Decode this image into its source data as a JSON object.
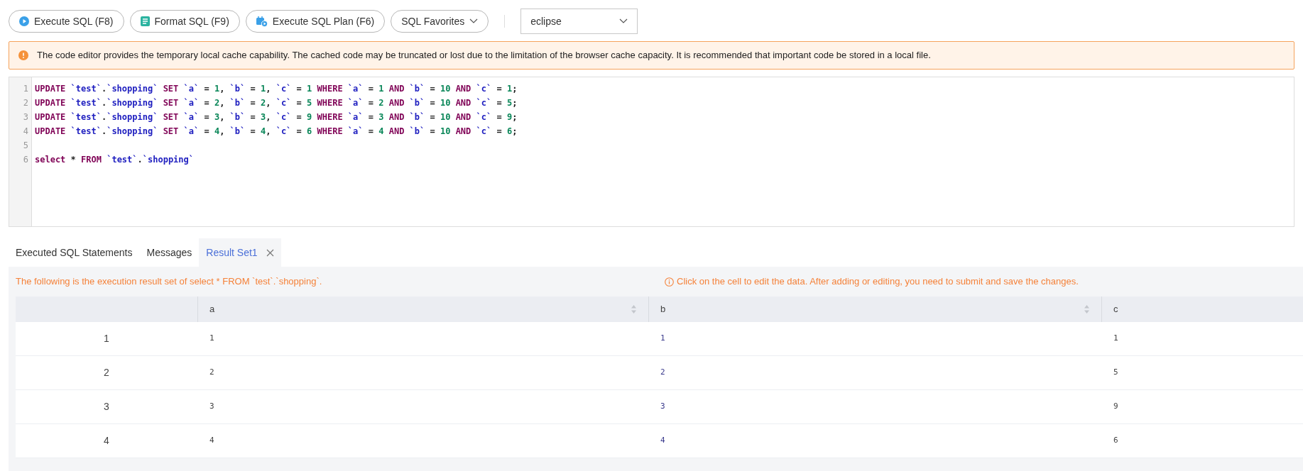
{
  "toolbar": {
    "buttons": [
      {
        "kind": "execute",
        "label": "Execute SQL (F8)"
      },
      {
        "kind": "format",
        "label": "Format SQL (F9)"
      },
      {
        "kind": "plan",
        "label": "Execute SQL Plan (F6)"
      },
      {
        "kind": "dropdown",
        "label": "SQL Favorites"
      }
    ],
    "theme_select": {
      "value": "eclipse"
    }
  },
  "notice": {
    "text": "The code editor provides the temporary local cache capability. The cached code may be truncated or lost due to the limitation of the browser cache capacity. It is recommended that important code be stored in a local file."
  },
  "editor": {
    "lines": [
      {
        "number": "1",
        "tokens": [
          {
            "kind": "keyword",
            "text": "UPDATE"
          },
          {
            "kind": "ident",
            "text": " `test`"
          },
          {
            "kind": "plain",
            "text": "."
          },
          {
            "kind": "ident",
            "text": "`shopping`"
          },
          {
            "kind": "keyword",
            "text": " SET"
          },
          {
            "kind": "ident",
            "text": " `a`"
          },
          {
            "kind": "plain",
            "text": " = "
          },
          {
            "kind": "number",
            "text": "1"
          },
          {
            "kind": "plain",
            "text": ", "
          },
          {
            "kind": "ident",
            "text": "`b`"
          },
          {
            "kind": "plain",
            "text": " = "
          },
          {
            "kind": "number",
            "text": "1"
          },
          {
            "kind": "plain",
            "text": ", "
          },
          {
            "kind": "ident",
            "text": "`c`"
          },
          {
            "kind": "plain",
            "text": " = "
          },
          {
            "kind": "number",
            "text": "1"
          },
          {
            "kind": "keyword",
            "text": " WHERE"
          },
          {
            "kind": "ident",
            "text": " `a`"
          },
          {
            "kind": "plain",
            "text": " = "
          },
          {
            "kind": "number",
            "text": "1"
          },
          {
            "kind": "keyword",
            "text": " AND"
          },
          {
            "kind": "ident",
            "text": " `b`"
          },
          {
            "kind": "plain",
            "text": " = "
          },
          {
            "kind": "number",
            "text": "10"
          },
          {
            "kind": "keyword",
            "text": " AND"
          },
          {
            "kind": "ident",
            "text": " `c`"
          },
          {
            "kind": "plain",
            "text": " = "
          },
          {
            "kind": "number",
            "text": "1"
          },
          {
            "kind": "plain",
            "text": ";"
          }
        ]
      },
      {
        "number": "2",
        "tokens": [
          {
            "kind": "keyword",
            "text": "UPDATE"
          },
          {
            "kind": "ident",
            "text": " `test`"
          },
          {
            "kind": "plain",
            "text": "."
          },
          {
            "kind": "ident",
            "text": "`shopping`"
          },
          {
            "kind": "keyword",
            "text": " SET"
          },
          {
            "kind": "ident",
            "text": " `a`"
          },
          {
            "kind": "plain",
            "text": " = "
          },
          {
            "kind": "number",
            "text": "2"
          },
          {
            "kind": "plain",
            "text": ", "
          },
          {
            "kind": "ident",
            "text": "`b`"
          },
          {
            "kind": "plain",
            "text": " = "
          },
          {
            "kind": "number",
            "text": "2"
          },
          {
            "kind": "plain",
            "text": ", "
          },
          {
            "kind": "ident",
            "text": "`c`"
          },
          {
            "kind": "plain",
            "text": " = "
          },
          {
            "kind": "number",
            "text": "5"
          },
          {
            "kind": "keyword",
            "text": " WHERE"
          },
          {
            "kind": "ident",
            "text": " `a`"
          },
          {
            "kind": "plain",
            "text": " = "
          },
          {
            "kind": "number",
            "text": "2"
          },
          {
            "kind": "keyword",
            "text": " AND"
          },
          {
            "kind": "ident",
            "text": " `b`"
          },
          {
            "kind": "plain",
            "text": " = "
          },
          {
            "kind": "number",
            "text": "10"
          },
          {
            "kind": "keyword",
            "text": " AND"
          },
          {
            "kind": "ident",
            "text": " `c`"
          },
          {
            "kind": "plain",
            "text": " = "
          },
          {
            "kind": "number",
            "text": "5"
          },
          {
            "kind": "plain",
            "text": ";"
          }
        ]
      },
      {
        "number": "3",
        "tokens": [
          {
            "kind": "keyword",
            "text": "UPDATE"
          },
          {
            "kind": "ident",
            "text": " `test`"
          },
          {
            "kind": "plain",
            "text": "."
          },
          {
            "kind": "ident",
            "text": "`shopping`"
          },
          {
            "kind": "keyword",
            "text": " SET"
          },
          {
            "kind": "ident",
            "text": " `a`"
          },
          {
            "kind": "plain",
            "text": " = "
          },
          {
            "kind": "number",
            "text": "3"
          },
          {
            "kind": "plain",
            "text": ", "
          },
          {
            "kind": "ident",
            "text": "`b`"
          },
          {
            "kind": "plain",
            "text": " = "
          },
          {
            "kind": "number",
            "text": "3"
          },
          {
            "kind": "plain",
            "text": ", "
          },
          {
            "kind": "ident",
            "text": "`c`"
          },
          {
            "kind": "plain",
            "text": " = "
          },
          {
            "kind": "number",
            "text": "9"
          },
          {
            "kind": "keyword",
            "text": " WHERE"
          },
          {
            "kind": "ident",
            "text": " `a`"
          },
          {
            "kind": "plain",
            "text": " = "
          },
          {
            "kind": "number",
            "text": "3"
          },
          {
            "kind": "keyword",
            "text": " AND"
          },
          {
            "kind": "ident",
            "text": " `b`"
          },
          {
            "kind": "plain",
            "text": " = "
          },
          {
            "kind": "number",
            "text": "10"
          },
          {
            "kind": "keyword",
            "text": " AND"
          },
          {
            "kind": "ident",
            "text": " `c`"
          },
          {
            "kind": "plain",
            "text": " = "
          },
          {
            "kind": "number",
            "text": "9"
          },
          {
            "kind": "plain",
            "text": ";"
          }
        ]
      },
      {
        "number": "4",
        "tokens": [
          {
            "kind": "keyword",
            "text": "UPDATE"
          },
          {
            "kind": "ident",
            "text": " `test`"
          },
          {
            "kind": "plain",
            "text": "."
          },
          {
            "kind": "ident",
            "text": "`shopping`"
          },
          {
            "kind": "keyword",
            "text": " SET"
          },
          {
            "kind": "ident",
            "text": " `a`"
          },
          {
            "kind": "plain",
            "text": " = "
          },
          {
            "kind": "number",
            "text": "4"
          },
          {
            "kind": "plain",
            "text": ", "
          },
          {
            "kind": "ident",
            "text": "`b`"
          },
          {
            "kind": "plain",
            "text": " = "
          },
          {
            "kind": "number",
            "text": "4"
          },
          {
            "kind": "plain",
            "text": ", "
          },
          {
            "kind": "ident",
            "text": "`c`"
          },
          {
            "kind": "plain",
            "text": " = "
          },
          {
            "kind": "number",
            "text": "6"
          },
          {
            "kind": "keyword",
            "text": " WHERE"
          },
          {
            "kind": "ident",
            "text": " `a`"
          },
          {
            "kind": "plain",
            "text": " = "
          },
          {
            "kind": "number",
            "text": "4"
          },
          {
            "kind": "keyword",
            "text": " AND"
          },
          {
            "kind": "ident",
            "text": " `b`"
          },
          {
            "kind": "plain",
            "text": " = "
          },
          {
            "kind": "number",
            "text": "10"
          },
          {
            "kind": "keyword",
            "text": " AND"
          },
          {
            "kind": "ident",
            "text": " `c`"
          },
          {
            "kind": "plain",
            "text": " = "
          },
          {
            "kind": "number",
            "text": "6"
          },
          {
            "kind": "plain",
            "text": ";"
          }
        ]
      },
      {
        "number": "5"
      },
      {
        "number": "6",
        "tokens": [
          {
            "kind": "keyword",
            "text": "select"
          },
          {
            "kind": "plain",
            "text": " * "
          },
          {
            "kind": "keyword",
            "text": "FROM"
          },
          {
            "kind": "ident",
            "text": " `test`"
          },
          {
            "kind": "plain",
            "text": "."
          },
          {
            "kind": "ident",
            "text": "`shopping`"
          }
        ]
      }
    ]
  },
  "result_tabs": [
    {
      "label": "Executed SQL Statements",
      "selected": false,
      "closable": false
    },
    {
      "label": "Messages",
      "selected": false,
      "closable": false
    },
    {
      "label": "Result Set1",
      "selected": true,
      "closable": true
    }
  ],
  "result": {
    "summary": "The following is the execution result set of select * FROM `test`.`shopping`.",
    "hint": "Click on the cell to edit the data. After adding or editing, you need to submit and save the changes.",
    "table": {
      "columns": [
        {
          "label": "a",
          "sortable": true
        },
        {
          "label": "b",
          "sortable": true
        },
        {
          "label": "c",
          "sortable": false
        }
      ],
      "rows": [
        {
          "index": "1",
          "cells": [
            "1",
            "1",
            "1"
          ]
        },
        {
          "index": "2",
          "cells": [
            "2",
            "2",
            "5"
          ]
        },
        {
          "index": "3",
          "cells": [
            "3",
            "3",
            "9"
          ]
        },
        {
          "index": "4",
          "cells": [
            "4",
            "4",
            "6"
          ]
        }
      ]
    }
  }
}
